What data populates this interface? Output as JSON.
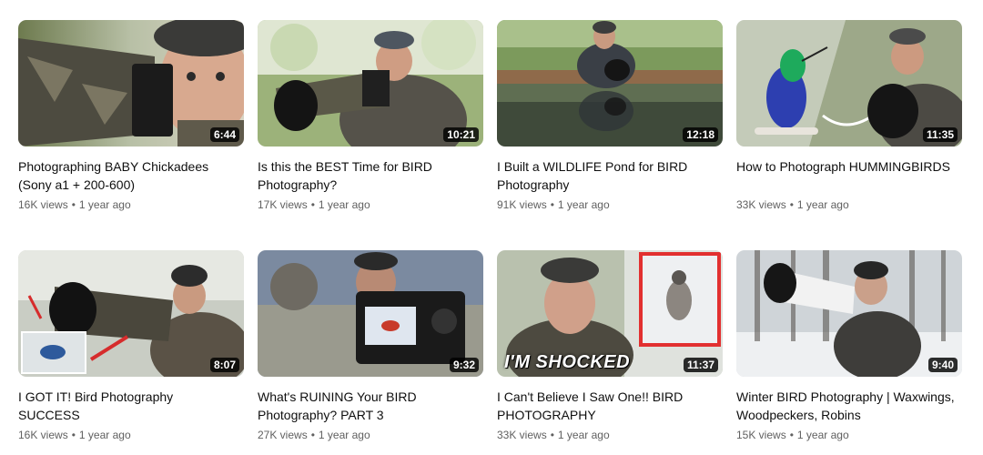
{
  "videos": [
    {
      "title": "Photographing BABY Chickadees (Sony a1 + 200-600)",
      "views": "16K views",
      "age": "1 year ago",
      "duration": "6:44",
      "thumb": "chickadee"
    },
    {
      "title": "Is this the BEST Time for BIRD Photography?",
      "views": "17K views",
      "age": "1 year ago",
      "duration": "10:21",
      "thumb": "besttime"
    },
    {
      "title": "I Built a WILDLIFE Pond for BIRD Photography",
      "views": "91K views",
      "age": "1 year ago",
      "duration": "12:18",
      "thumb": "pond"
    },
    {
      "title": "How to Photograph HUMMINGBIRDS",
      "views": "33K views",
      "age": "1 year ago",
      "duration": "11:35",
      "thumb": "hummingbird"
    },
    {
      "title": "I GOT IT! Bird Photography SUCCESS",
      "views": "16K views",
      "age": "1 year ago",
      "duration": "8:07",
      "thumb": "success"
    },
    {
      "title": "What's RUINING Your BIRD Photography? PART 3",
      "views": "27K views",
      "age": "1 year ago",
      "duration": "9:32",
      "thumb": "ruining"
    },
    {
      "title": "I Can't Believe I Saw One!! BIRD PHOTOGRAPHY",
      "views": "33K views",
      "age": "1 year ago",
      "duration": "11:37",
      "thumb": "shocked",
      "overlay_text": "I'M SHOCKED"
    },
    {
      "title": "Winter BIRD Photography | Waxwings, Woodpeckers, Robins",
      "views": "15K views",
      "age": "1 year ago",
      "duration": "9:40",
      "thumb": "winter"
    }
  ],
  "separator": "•",
  "colors": {
    "title": "#0f0f0f",
    "meta": "#606060",
    "badge_bg": "#000000cc"
  }
}
